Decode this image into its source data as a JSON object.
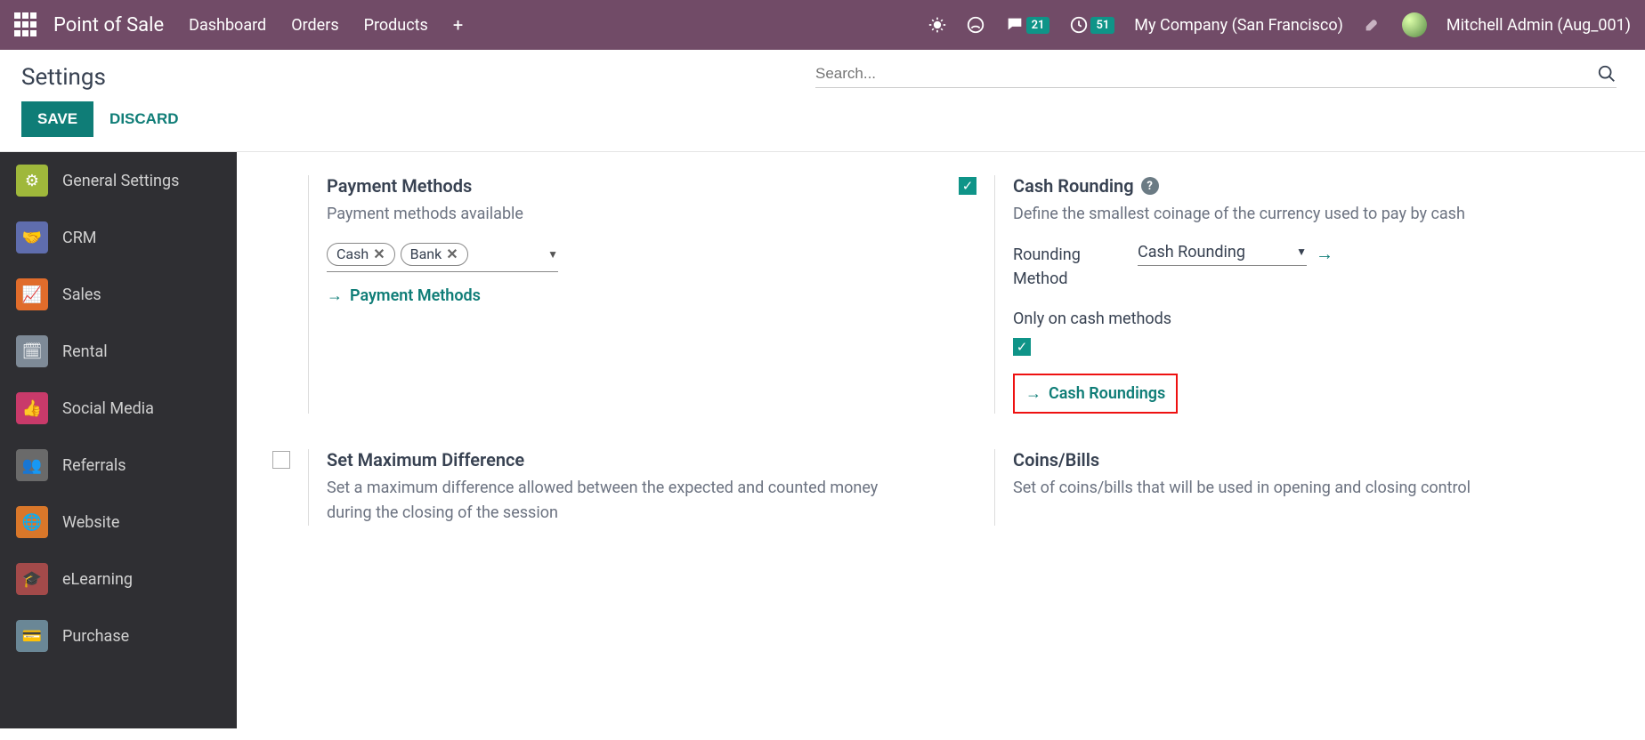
{
  "topbar": {
    "brand": "Point of Sale",
    "nav": [
      "Dashboard",
      "Orders",
      "Products"
    ],
    "messages_badge": "21",
    "activities_badge": "51",
    "company": "My Company (San Francisco)",
    "user": "Mitchell Admin (Aug_001)"
  },
  "page": {
    "title": "Settings",
    "search_placeholder": "Search...",
    "save": "SAVE",
    "discard": "DISCARD"
  },
  "sidebar": {
    "items": [
      {
        "label": "General Settings",
        "color": "#9fb83b"
      },
      {
        "label": "CRM",
        "color": "#5f6dad"
      },
      {
        "label": "Sales",
        "color": "#e06c2b"
      },
      {
        "label": "Rental",
        "color": "#7e8a97"
      },
      {
        "label": "Social Media",
        "color": "#c93a6a"
      },
      {
        "label": "Referrals",
        "color": "#6a6a6a"
      },
      {
        "label": "Website",
        "color": "#d9772a"
      },
      {
        "label": "eLearning",
        "color": "#a34a4a"
      },
      {
        "label": "Purchase",
        "color": "#6a8796"
      }
    ]
  },
  "settings": {
    "payment_methods": {
      "title": "Payment Methods",
      "desc": "Payment methods available",
      "tags": [
        "Cash",
        "Bank"
      ],
      "link": "Payment Methods"
    },
    "cash_rounding": {
      "title": "Cash Rounding",
      "desc": "Define the smallest coinage of the currency used to pay by cash",
      "field_label": "Rounding Method",
      "field_value": "Cash Rounding",
      "only_cash_label": "Only on cash methods",
      "link": "Cash Roundings"
    },
    "max_diff": {
      "title": "Set Maximum Difference",
      "desc": "Set a maximum difference allowed between the expected and counted money during the closing of the session"
    },
    "coins": {
      "title": "Coins/Bills",
      "desc": "Set of coins/bills that will be used in opening and closing control"
    }
  }
}
